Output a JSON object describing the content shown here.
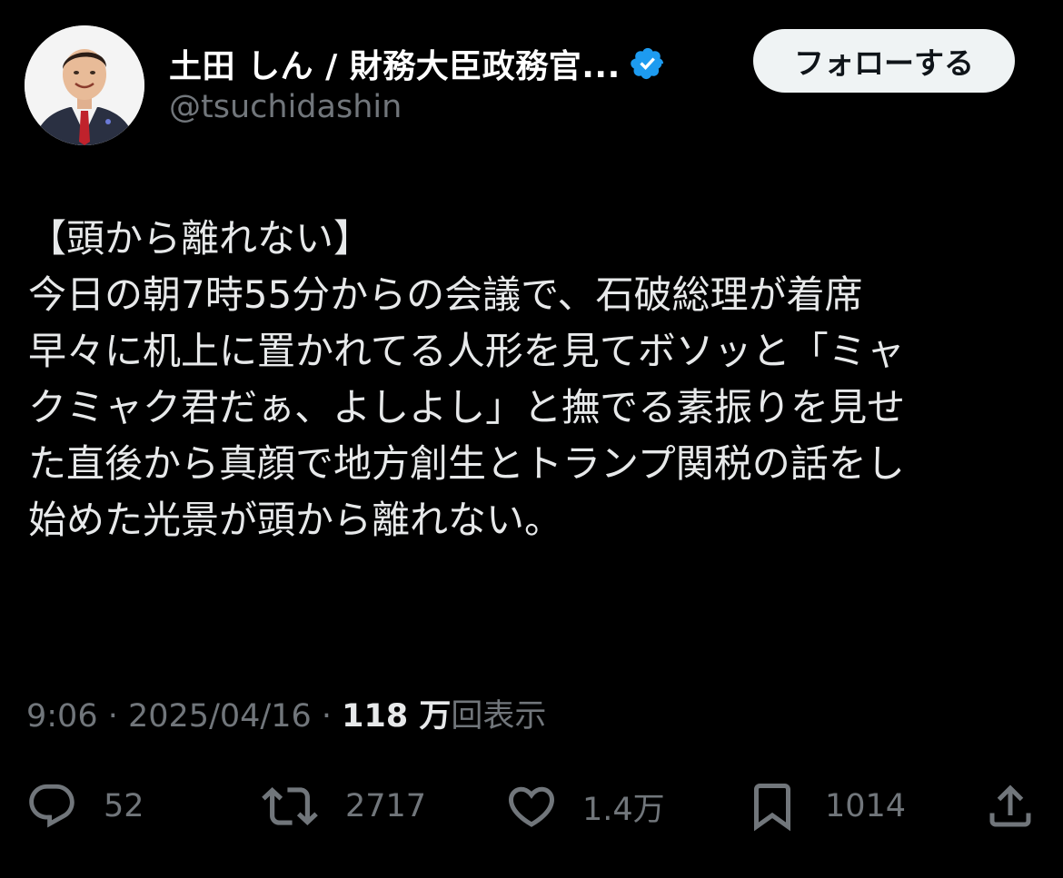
{
  "author": {
    "display_name": "土田 しん / 財務大臣政務官...",
    "handle": "@tsuchidashin",
    "verified": true
  },
  "follow_button": {
    "label": "フォローする"
  },
  "tweet": {
    "lines": [
      "【頭から離れない】",
      "今日の朝7時55分からの会議で、石破総理が着席",
      "早々に机上に置かれてる人形を見てボソッと「ミャ",
      "クミャク君だぁ、よしよし」と撫でる素振りを見せ",
      "た直後から真顔で地方創生とトランプ関税の話をし",
      "始めた光景が頭から離れない。"
    ],
    "time": "9:06",
    "date": "2025/04/16",
    "views_count": "118 万",
    "views_label": "回表示",
    "separator": " · "
  },
  "actions": {
    "replies": "52",
    "retweets": "2717",
    "likes": "1.4万",
    "bookmarks": "1014"
  },
  "colors": {
    "background": "#000000",
    "text": "#e7e9ea",
    "muted": "#71767b",
    "verified_blue": "#1d9bf0",
    "follow_bg": "#eff3f4"
  },
  "icons": {
    "verified": "verified-badge-icon",
    "reply": "reply-bubble-icon",
    "retweet": "retweet-icon",
    "like": "heart-icon",
    "bookmark": "bookmark-icon",
    "share": "share-icon"
  }
}
